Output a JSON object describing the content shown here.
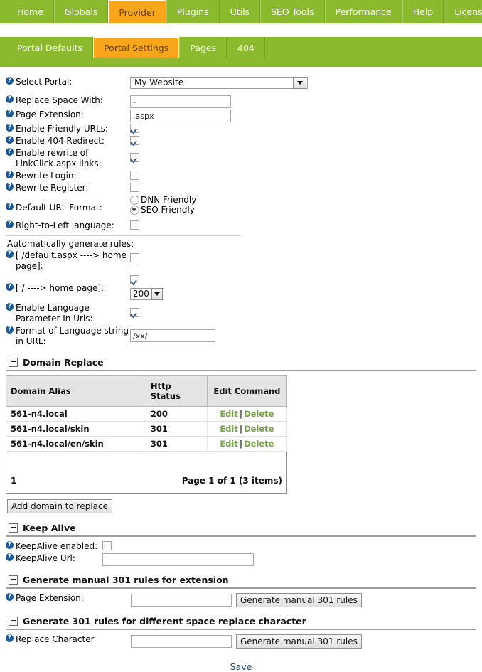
{
  "nav": {
    "items": [
      {
        "label": "Home",
        "active": false
      },
      {
        "label": "Globals",
        "active": false
      },
      {
        "label": "Provider",
        "active": true
      },
      {
        "label": "Plugins",
        "active": false
      },
      {
        "label": "Utils",
        "active": false
      },
      {
        "label": "SEO Tools",
        "active": false
      },
      {
        "label": "Performance",
        "active": false
      },
      {
        "label": "Help",
        "active": false
      },
      {
        "label": "License",
        "active": false
      }
    ]
  },
  "subnav": {
    "items": [
      {
        "label": "Portal Defaults",
        "active": false
      },
      {
        "label": "Portal Settings",
        "active": true
      },
      {
        "label": "Pages",
        "active": false
      },
      {
        "label": "404",
        "active": false
      }
    ]
  },
  "form": {
    "select_portal_label": "Select Portal:",
    "select_portal_value": "My Website",
    "replace_space_label": "Replace Space With:",
    "replace_space_value": "-",
    "page_extension_label": "Page Extension:",
    "page_extension_value": ".aspx",
    "enable_friendly_urls_label": "Enable Friendly URLs:",
    "enable_404_redirect_label": "Enable 404 Redirect:",
    "enable_rewrite_linkclick_label": "Enable rewrite of LinkClick.aspx links:",
    "rewrite_login_label": "Rewrite Login:",
    "rewrite_register_label": "Rewrite Register:",
    "default_url_format_label": "Default URL Format:",
    "url_format_option_dnn": "DNN Friendly",
    "url_format_option_seo": "SEO Friendly",
    "rtl_label": "Right-to-Left language:",
    "auto_rules_label": "Automatically generate rules:",
    "default_aspx_home_label": "[ /default.aspx ----> home page]:",
    "slash_home_label": "[ / ----> home page]:",
    "slash_home_status_value": "200",
    "enable_language_param_label": "Enable Language Parameter In Urls:",
    "language_format_label": "Format of Language string in URL:",
    "language_format_value": "/xx/"
  },
  "domain_replace": {
    "section_title": "Domain Replace",
    "columns": [
      "Domain Alias",
      "Http Status",
      "Edit Command"
    ],
    "rows": [
      {
        "alias": "561-n4.local",
        "status": "200",
        "edit": "Edit",
        "delete": "Delete"
      },
      {
        "alias": "561-n4.local/skin",
        "status": "301",
        "edit": "Edit",
        "delete": "Delete"
      },
      {
        "alias": "561-n4.local/en/skin",
        "status": "301",
        "edit": "Edit",
        "delete": "Delete"
      }
    ],
    "page_number": "1",
    "page_summary": "Page 1 of 1 (3 items)",
    "add_button": "Add domain to replace"
  },
  "keep_alive": {
    "section_title": "Keep Alive",
    "enabled_label": "KeepAlive enabled:",
    "url_label": "KeepAlive Url:",
    "url_value": ""
  },
  "manual301_extension": {
    "section_title": "Generate manual 301 rules for extension",
    "field_label": "Page Extension:",
    "field_value": "",
    "button_label": "Generate manual 301 rules"
  },
  "manual301_space": {
    "section_title": "Generate 301 rules for different space replace character",
    "field_label": "Replace Character",
    "field_value": "",
    "button_label": "Generate manual 301 rules"
  },
  "footer": {
    "save_label": "Save"
  },
  "colors": {
    "nav_green": "#8cba2e",
    "active_orange": "#f9a61a",
    "link_green": "#76a347",
    "highlight_green": "#2f7d18",
    "save_link": "#1b4f8a"
  }
}
